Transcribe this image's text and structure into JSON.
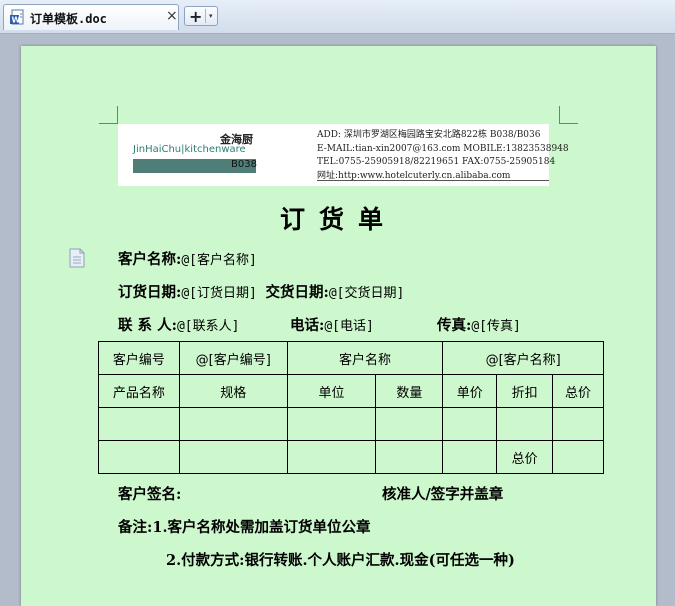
{
  "tab": {
    "title": "订单模板.doc",
    "close": "×"
  },
  "toolbar": {
    "new_tab": "+",
    "dropdown": "▾"
  },
  "header": {
    "logo_cn": "金海厨",
    "logo_en": "JinHaiChu|kitchenware",
    "logo_code": "B038",
    "contact": [
      "ADD: 深圳市罗湖区梅园路宝安北路822栋 B038/B036",
      "E-MAIL:tian-xin2007@163.com MOBILE:13823538948",
      "TEL:0755-25905918/82219651  FAX:0755-25905184",
      "网址:http:www.hotelcuterly.cn.alibaba.com"
    ]
  },
  "doc": {
    "title": "订货单",
    "customer_name_label": "客户名称:",
    "customer_name_field": "@[客户名称]",
    "order_date_label": "订货日期:",
    "order_date_field": "@[订货日期]",
    "delivery_date_label": "交货日期:",
    "delivery_date_field": "@[交货日期]",
    "contact_label": "联 系 人:",
    "contact_field": "@[联系人]",
    "phone_label": "电话:",
    "phone_field": "@[电话]",
    "fax_label": "传真:",
    "fax_field": "@[传真]",
    "table": {
      "row1": [
        "客户编号",
        "@[客户编号]",
        "客户名称",
        "@[客户名称]"
      ],
      "headers": [
        "产品名称",
        "规格",
        "单位",
        "数量",
        "单价",
        "折扣",
        "总价"
      ],
      "total_label": "总价"
    },
    "signature_label": "客户签名:",
    "approver_label": "核准人/签字并盖章",
    "note_1": "备注:1.客户名称处需加盖订货单位公章",
    "note_2": "2.付款方式:银行转账.个人账户汇款.现金(可任选一种)"
  }
}
